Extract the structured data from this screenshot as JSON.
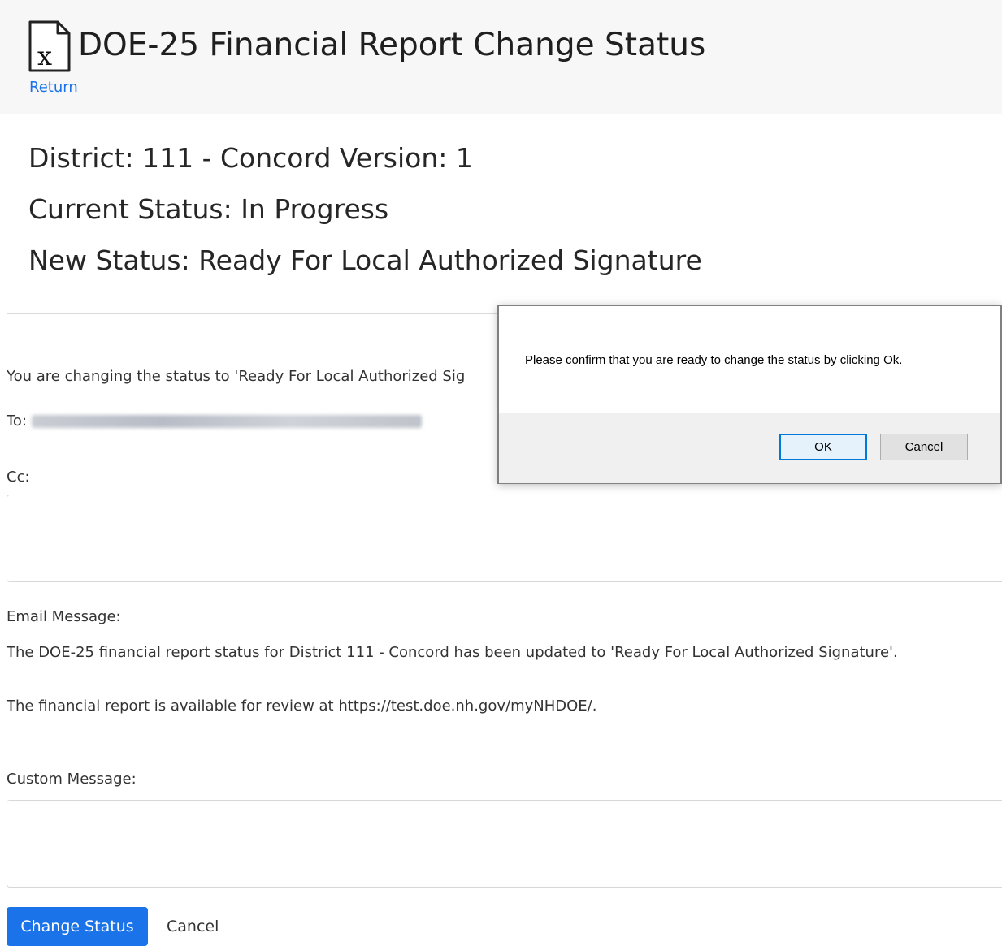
{
  "header": {
    "title": "DOE-25 Financial Report Change Status",
    "return_label": "Return",
    "icon": "excel-file-icon"
  },
  "info": {
    "district_version": "District: 111 - Concord Version: 1",
    "current_status": "Current Status: In Progress",
    "new_status": "New Status: Ready For Local Authorized Signature"
  },
  "form": {
    "changing_text": "You are changing the status to 'Ready For Local Authorized Sig",
    "to_label": "To:",
    "cc_label": "Cc:",
    "cc_value": "",
    "email_message_label": "Email Message:",
    "email_message_line1": "The DOE-25 financial report status for District 111 - Concord has been updated to 'Ready For Local Authorized Signature'.",
    "email_message_line2": "The financial report is available for review at https://test.doe.nh.gov/myNHDOE/.",
    "custom_message_label": "Custom Message:",
    "custom_message_value": ""
  },
  "actions": {
    "change_status_label": "Change Status",
    "cancel_label": "Cancel"
  },
  "dialog": {
    "message": "Please confirm that you are ready to change the status by clicking Ok.",
    "ok_label": "OK",
    "cancel_label": "Cancel"
  },
  "colors": {
    "primary": "#1a73e8",
    "header_bg": "#f7f7f8",
    "dialog_footer_bg": "#f0f0f0"
  }
}
